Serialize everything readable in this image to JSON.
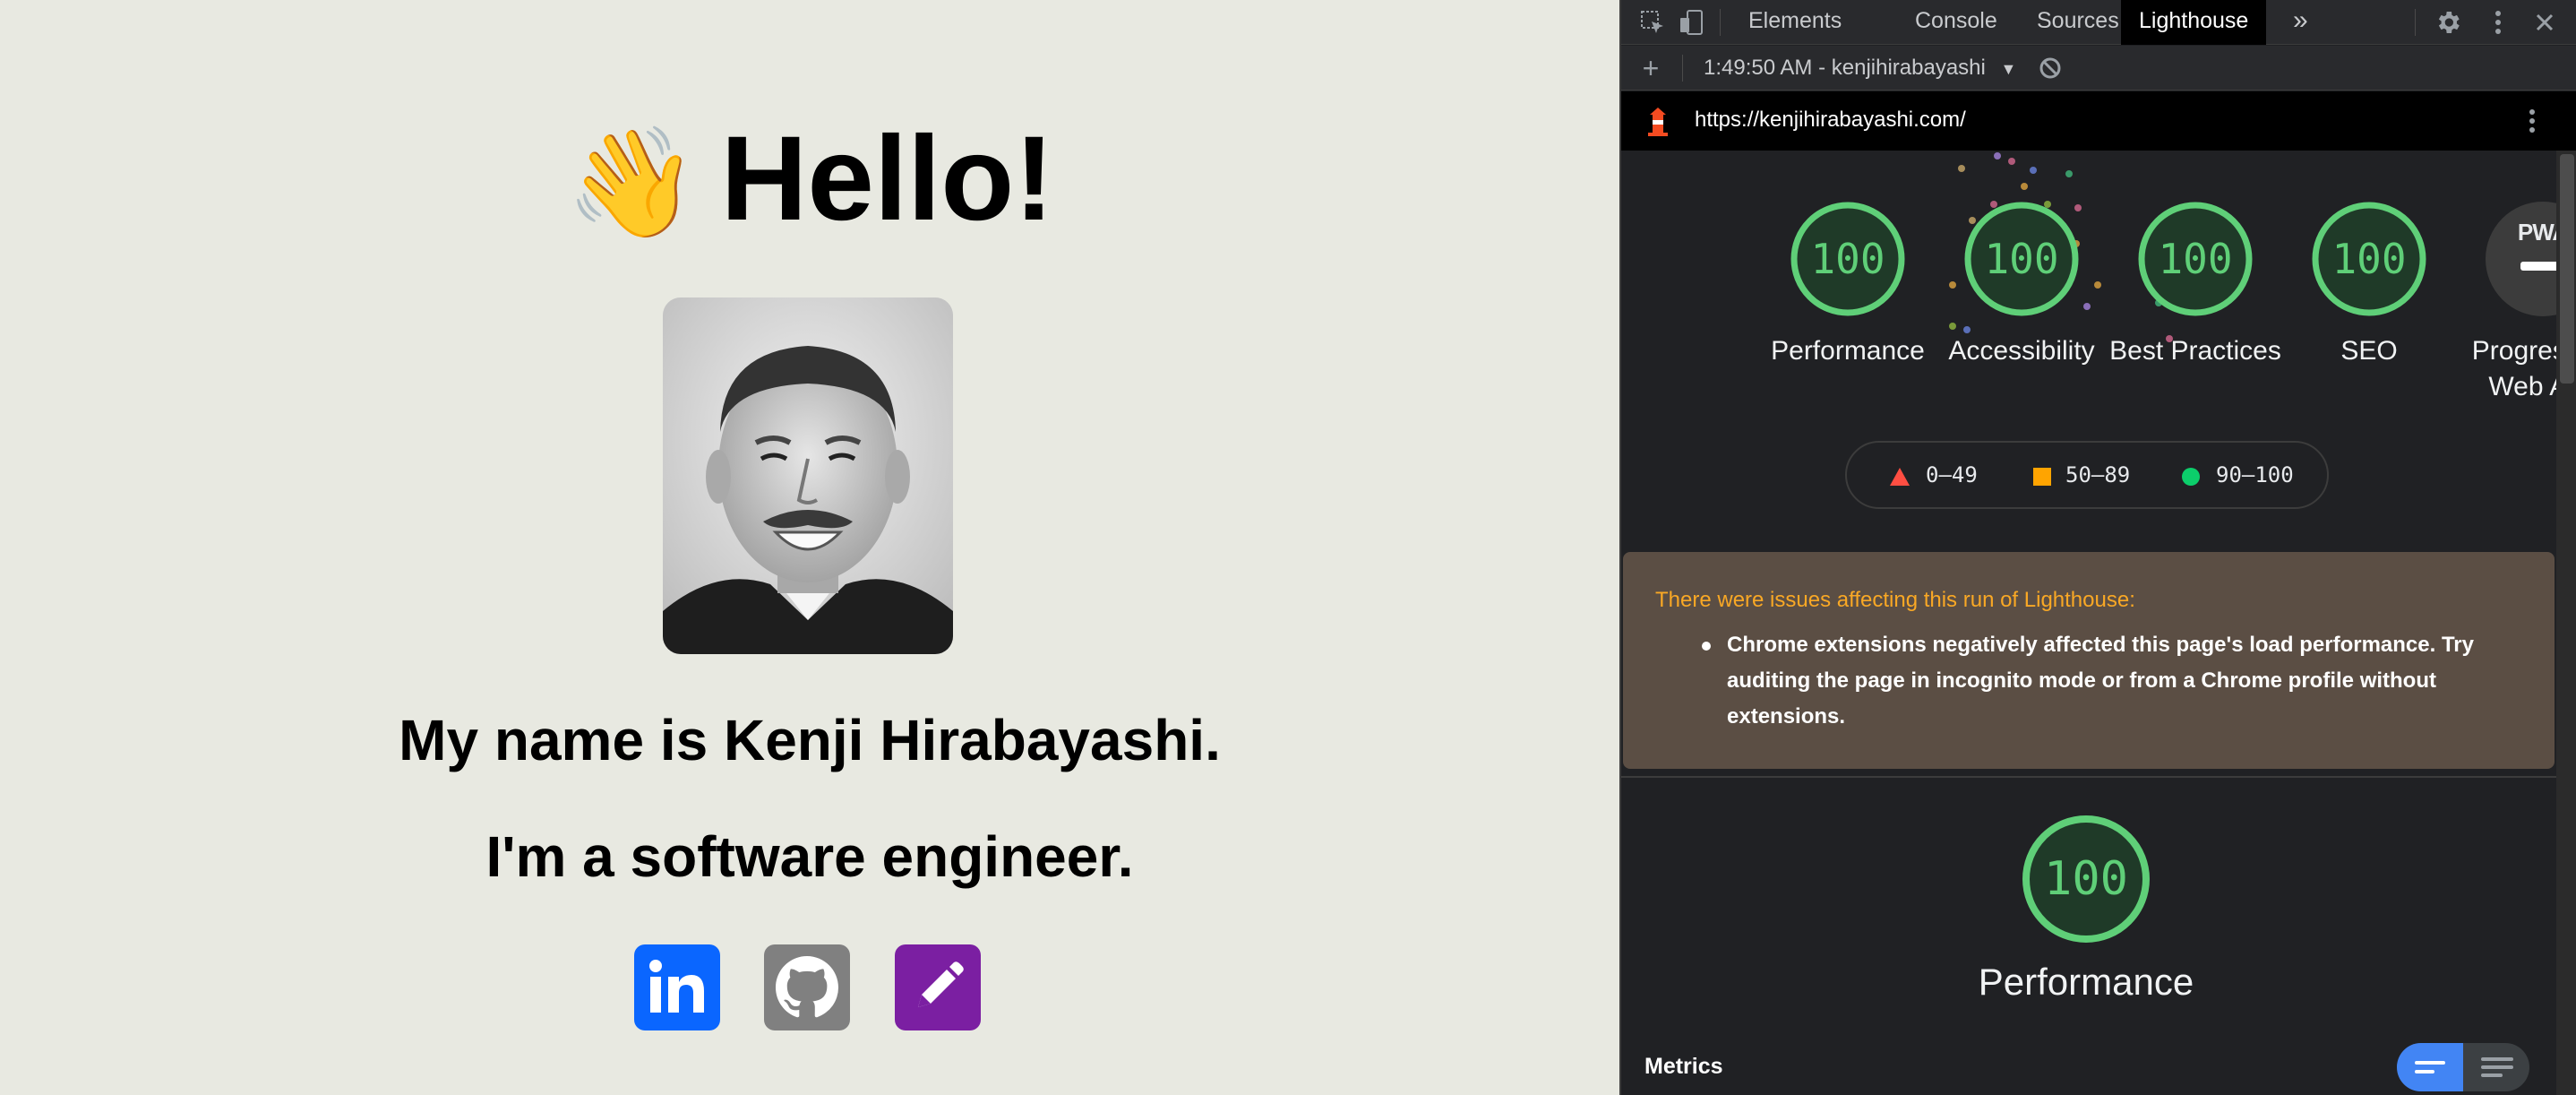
{
  "page": {
    "wave_emoji": "👋",
    "greeting": "Hello!",
    "name_line": "My name is Kenji Hirabayashi.",
    "job_line": "I'm a software engineer.",
    "social_links": [
      {
        "name": "linkedin",
        "icon": "linkedin-icon",
        "color": "#0a66ff"
      },
      {
        "name": "github",
        "icon": "github-icon",
        "color": "#808080"
      },
      {
        "name": "blog",
        "icon": "pencil-icon",
        "color": "#7b1fa2"
      }
    ]
  },
  "devtools": {
    "tabs": [
      "Elements",
      "Console",
      "Sources",
      "Lighthouse"
    ],
    "active_tab": "Lighthouse",
    "more_tabs": "»",
    "toolbar": {
      "add_label": "+",
      "report_select": "1:49:50 AM - kenjihirabayashi",
      "dropdown_arrow": "▼"
    },
    "url": "https://kenjihirabayashi.com/",
    "scores": [
      {
        "label": "Performance",
        "value": "100"
      },
      {
        "label": "Accessibility",
        "value": "100"
      },
      {
        "label": "Best Practices",
        "value": "100"
      },
      {
        "label": "SEO",
        "value": "100"
      },
      {
        "label": "Progressive Web App",
        "value": "PWA"
      }
    ],
    "legend": [
      {
        "range": "0–49",
        "color": "#ff4e42",
        "shape": "triangle"
      },
      {
        "range": "50–89",
        "color": "#ffa400",
        "shape": "square"
      },
      {
        "range": "90–100",
        "color": "#0cce6b",
        "shape": "circle"
      }
    ],
    "warning": {
      "title": "There were issues affecting this run of Lighthouse:",
      "item": "Chrome extensions negatively affected this page's load performance. Try auditing the page in incognito mode or from a Chrome profile without extensions."
    },
    "main_score": {
      "value": "100",
      "label": "Performance"
    },
    "metrics_label": "Metrics",
    "colors": {
      "pass": "#5fcf78",
      "warning_text": "#f9a825",
      "accent": "#4285f4"
    }
  }
}
